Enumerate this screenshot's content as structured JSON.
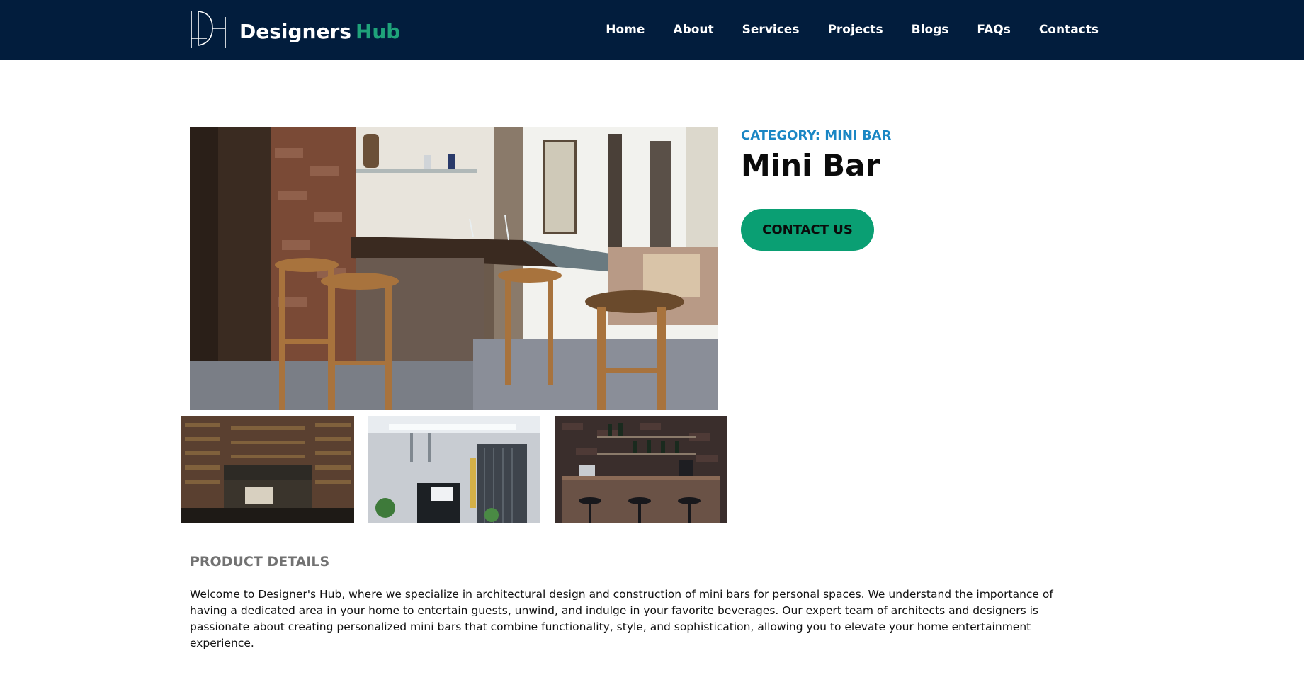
{
  "header": {
    "brand_part1": "Designers",
    "brand_part2": "Hub",
    "nav": [
      "Home",
      "About",
      "Services",
      "Projects",
      "Blogs",
      "FAQs",
      "Contacts"
    ]
  },
  "product": {
    "category": "CATEGORY: MINI BAR",
    "title": "Mini Bar",
    "cta_label": "CONTACT US"
  },
  "details": {
    "heading": "PRODUCT DETAILS",
    "text": "Welcome to Designer's Hub, where we specialize in architectural design and construction of mini bars for personal spaces. We understand the importance of having a dedicated area in your home to entertain guests, unwind, and indulge in your favorite beverages. Our expert team of architects and designers is passionate about creating personalized mini bars that combine functionality, style, and sophistication, allowing you to elevate your home entertainment experience."
  },
  "colors": {
    "navbar": "#021d3d",
    "accent_green": "#0a9f73",
    "brand_green": "#1fa37a",
    "category_blue": "#1a86c4"
  }
}
